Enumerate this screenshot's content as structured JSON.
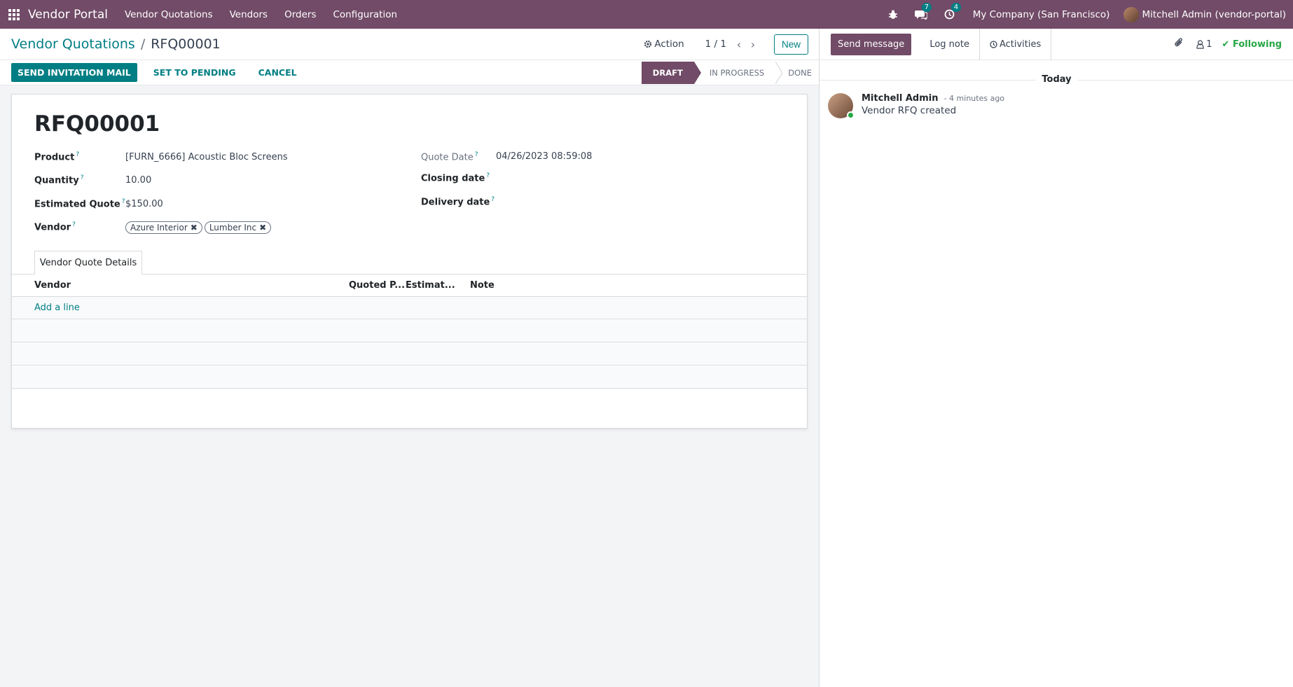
{
  "navbar": {
    "brand": "Vendor Portal",
    "menu": [
      "Vendor Quotations",
      "Vendors",
      "Orders",
      "Configuration"
    ],
    "messages_count": "7",
    "activities_count": "4",
    "company": "My Company (San Francisco)",
    "user": "Mitchell Admin (vendor-portal)"
  },
  "breadcrumb": {
    "parent": "Vendor Quotations",
    "separator": "/",
    "current": "RFQ00001"
  },
  "control": {
    "action_label": "Action",
    "pager": "1 / 1",
    "new_label": "New"
  },
  "buttons": {
    "send_invitation": "SEND INVITATION MAIL",
    "set_pending": "SET TO PENDING",
    "cancel": "CANCEL"
  },
  "stages": [
    "DRAFT",
    "IN PROGRESS",
    "DONE"
  ],
  "form": {
    "title": "RFQ00001",
    "product_label": "Product",
    "product_value": "[FURN_6666] Acoustic Bloc Screens",
    "quantity_label": "Quantity",
    "quantity_value": "10.00",
    "estimated_label": "Estimated Quote",
    "estimated_value": "$150.00",
    "vendor_label": "Vendor",
    "vendors": [
      "Azure Interior",
      "Lumber Inc"
    ],
    "quote_date_label": "Quote Date",
    "quote_date_value": "04/26/2023 08:59:08",
    "closing_label": "Closing date",
    "delivery_label": "Delivery date",
    "help_mark": "?"
  },
  "tab": {
    "label": "Vendor Quote Details"
  },
  "table": {
    "columns": [
      "Vendor",
      "Quoted P...",
      "Estimat...",
      "Note"
    ],
    "add_line": "Add a line"
  },
  "chatter": {
    "send_message": "Send message",
    "log_note": "Log note",
    "activities": "Activities",
    "followers_count": "1",
    "following": "Following",
    "today": "Today",
    "message": {
      "author": "Mitchell Admin",
      "time": "- 4 minutes ago",
      "body": "Vendor RFQ created"
    }
  },
  "colors": {
    "brand": "#714b67",
    "accent": "#017e84",
    "following": "#28a745"
  }
}
